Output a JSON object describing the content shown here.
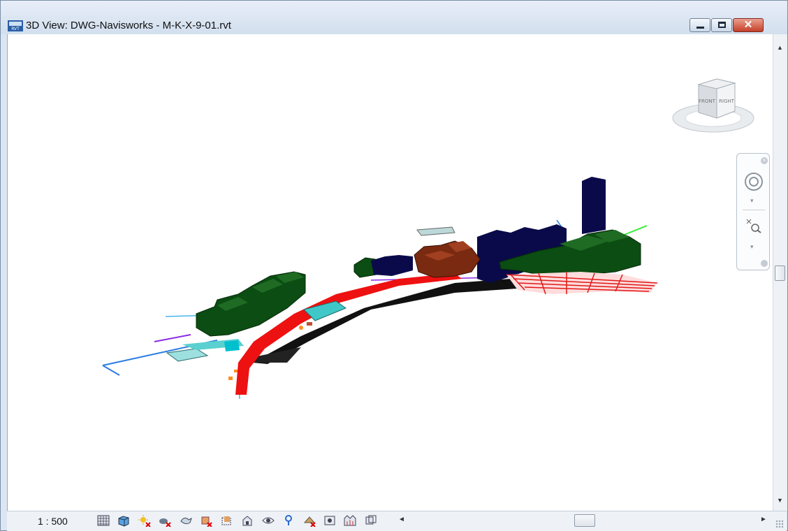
{
  "window": {
    "title": "3D View: DWG-Navisworks - M-K-X-9-01.rvt",
    "icon": "rvt-file-icon",
    "controls": {
      "minimize": "minimize-icon",
      "maximize": "maximize-icon",
      "close": "close-icon",
      "close_glyph": "✕"
    }
  },
  "viewport": {
    "content": "3d-model-view",
    "viewcube": {
      "faces": [
        "FRONT",
        "RIGHT"
      ]
    },
    "nav_bar": {
      "tools": [
        "steering-wheel-icon",
        "zoom-icon"
      ]
    }
  },
  "scrollbars": {
    "up_glyph": "▲",
    "down_glyph": "▼",
    "left_glyph": "◄",
    "right_glyph": "►"
  },
  "status_bar": {
    "scale": "1 : 500",
    "view_control_icons": [
      "detail-level-icon",
      "visual-style-icon",
      "sun-path-icon",
      "shadows-icon",
      "render-icon",
      "crop-view-icon",
      "show-crop-region-icon",
      "unlock-3d-view-icon",
      "temporary-hide-isolate-icon",
      "reveal-hidden-elements-icon",
      "temporary-view-properties-icon",
      "analytical-model-icon",
      "highlight-displacement-icon",
      "reveal-constraints-icon"
    ]
  },
  "colors": {
    "building_green": "#0b4d12",
    "building_navy": "#0a0a4a",
    "building_brown": "#7a2a10",
    "road_red": "#ee1111",
    "water_cyan": "#40c8c8",
    "pipe_blue": "#2a7de1"
  }
}
